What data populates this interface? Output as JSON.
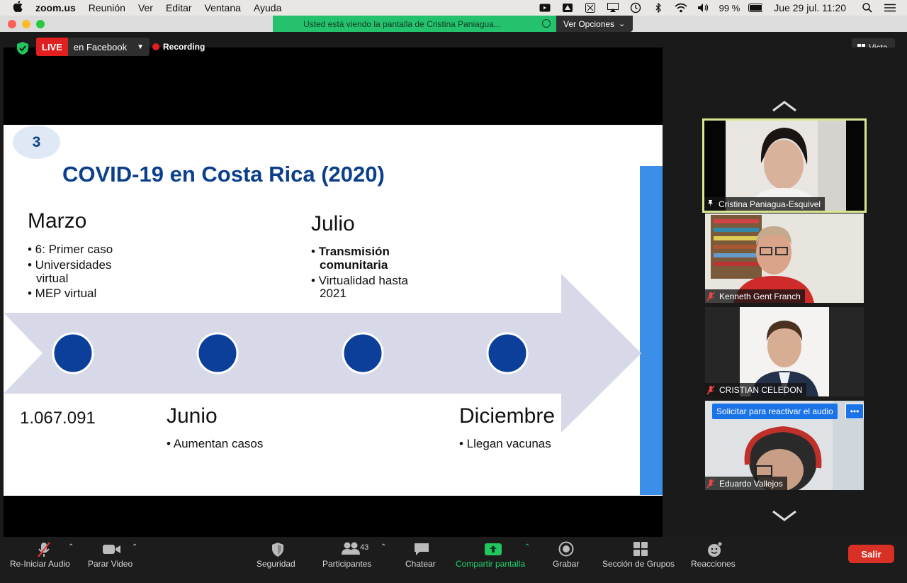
{
  "menubar": {
    "app": "zoom.us",
    "menus": [
      "Reunión",
      "Ver",
      "Editar",
      "Ventana",
      "Ayuda"
    ],
    "battery": "99 %",
    "datetime": "Jue 29 jul.  11:20"
  },
  "window": {
    "share_banner": "Usted está viendo la pantalla de Cristina Paniagua...",
    "view_options": "Ver Opciones",
    "view_options_caret": "⌄"
  },
  "overlay": {
    "live_label": "LIVE",
    "live_destination": "en Facebook",
    "recording": "Recording",
    "view_button": "Vista"
  },
  "slide": {
    "number": "3",
    "title": "COVID-19 en Costa Rica (2020)",
    "marzo": {
      "title": "Marzo",
      "bullets": [
        "• 6: Primer caso",
        "• Universidades",
        "virtual",
        "• MEP virtual"
      ]
    },
    "julio": {
      "title": "Julio",
      "bullet_bold_1": "Transmisión",
      "bullet_bold_2": "comunitaria",
      "bullets": [
        "• Virtualidad hasta",
        "2021"
      ]
    },
    "number_below": "1.067.091",
    "junio": {
      "title": "Junio",
      "bullets": [
        "• Aumentan casos"
      ]
    },
    "diciembre": {
      "title": "Diciembre",
      "bullets": [
        "• Llegan vacunas"
      ]
    }
  },
  "participants": [
    {
      "name": "Cristina Paniagua-Esquivel",
      "active": true,
      "audio": "on"
    },
    {
      "name": "Kenneth Gent Franch",
      "active": false,
      "audio": "muted"
    },
    {
      "name": "CRISTIAN CELEDON",
      "active": false,
      "audio": "muted"
    },
    {
      "name": "Eduardo Vallejos",
      "active": false,
      "audio": "muted"
    }
  ],
  "unmute_request": {
    "label": "Solicitar para reactivar el audio",
    "more": "•••"
  },
  "toolbar": {
    "audio": "Re-Iniciar Audio",
    "video": "Parar Video",
    "security": "Seguridad",
    "participants": "Participantes",
    "participant_count": "43",
    "chat": "Chatear",
    "share": "Compartir pantalla",
    "record": "Grabar",
    "breakout": "Sección de Grupos",
    "reactions": "Reacciones",
    "leave": "Salir"
  },
  "colors": {
    "share_green": "#25c26d",
    "slide_blue": "#0b3f8c",
    "timeline_dot": "#0b3f9a",
    "timeline_arrow": "#d7d9e8",
    "live_red": "#e02020",
    "leave_red": "#d93025",
    "active_border": "#d8e78f"
  }
}
